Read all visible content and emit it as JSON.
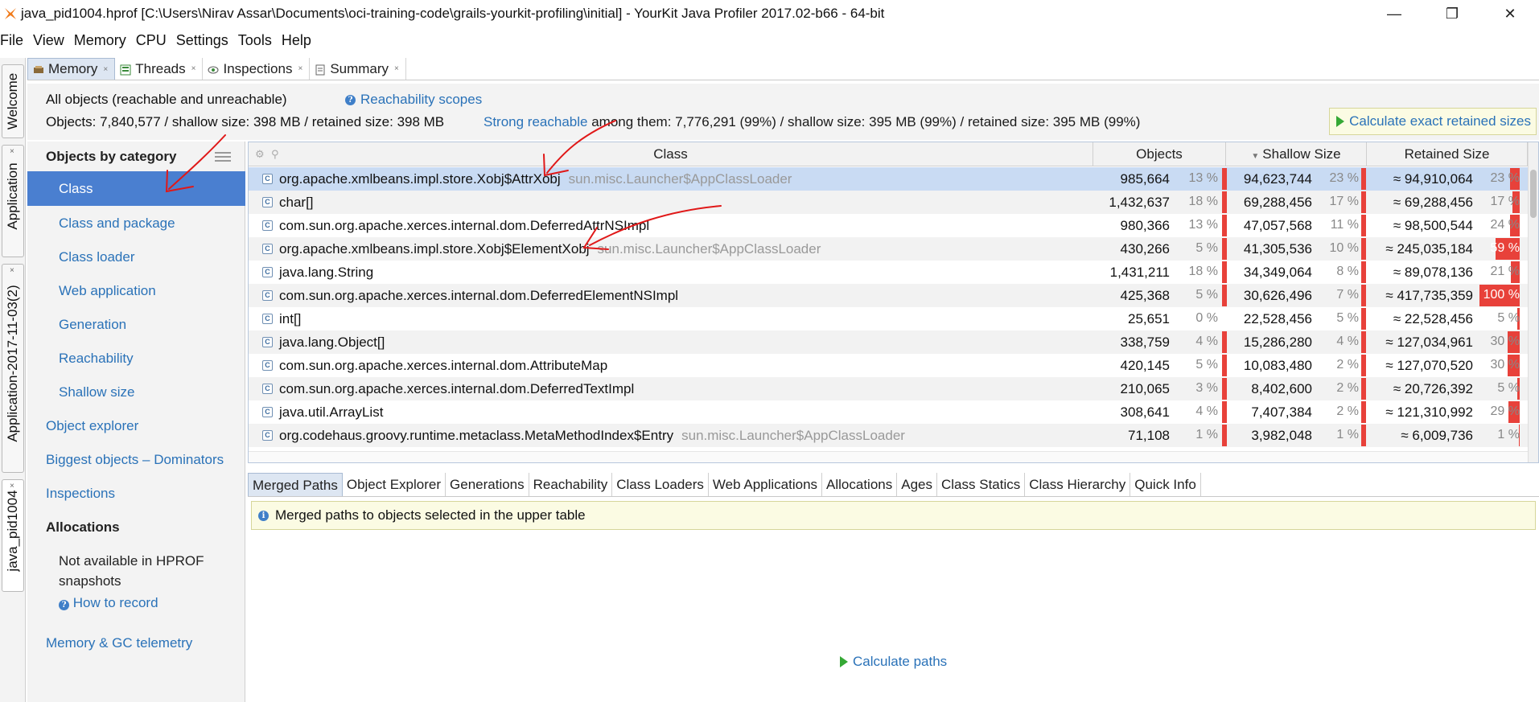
{
  "window": {
    "title": "java_pid1004.hprof [C:\\Users\\Nirav Assar\\Documents\\oci-training-code\\grails-yourkit-profiling\\initial] - YourKit Java Profiler 2017.02-b66 - 64-bit",
    "minimize": "—",
    "restore": "❐",
    "close": "✕"
  },
  "menu": [
    "File",
    "View",
    "Memory",
    "CPU",
    "Settings",
    "Tools",
    "Help"
  ],
  "vertical_tabs": [
    "Welcome",
    "Application",
    "Application-2017-11-03(2)",
    "java_pid1004"
  ],
  "top_tabs": [
    {
      "label": "Memory",
      "close": "×"
    },
    {
      "label": "Threads",
      "close": "×"
    },
    {
      "label": "Inspections",
      "close": "×"
    },
    {
      "label": "Summary",
      "close": "×"
    }
  ],
  "info": {
    "all_objects": "All objects (reachable and unreachable)",
    "reachability_scopes": "Reachability scopes",
    "objects_summary": "Objects: 7,840,577 / shallow size: 398 MB / retained size: 398 MB",
    "strong_reachable": "Strong reachable",
    "strong_summary": " among them: 7,776,291 (99%) / shallow size: 395 MB (99%) / retained size: 395 MB (99%)",
    "calc_retained": "Calculate exact retained sizes"
  },
  "categories": {
    "header": "Objects by category",
    "items": [
      "Class",
      "Class and package",
      "Class loader",
      "Web application",
      "Generation",
      "Reachability",
      "Shallow size"
    ],
    "object_explorer": "Object explorer",
    "biggest_objects": "Biggest objects – Dominators",
    "inspections": "Inspections",
    "allocations_header": "Allocations",
    "not_available": "Not available in HPROF",
    "snapshots": "snapshots",
    "how_to_record": "How to record",
    "memory_gc": "Memory & GC telemetry"
  },
  "table": {
    "columns": [
      "Class",
      "Objects",
      "Shallow Size",
      "Retained Size"
    ],
    "rows": [
      {
        "cls": "org.apache.xmlbeans.impl.store.Xobj$AttrXobj",
        "loader": "sun.misc.Launcher$AppClassLoader",
        "objects": "985,664",
        "obj_pct": "13 %",
        "obj_frac": 0.13,
        "shallow": "94,623,744",
        "sh_pct": "23 %",
        "sh_frac": 0.23,
        "retained": "≈ 94,910,064",
        "ret_pct": "23 %",
        "ret_frac": 0.23
      },
      {
        "cls": "char[]",
        "loader": "",
        "objects": "1,432,637",
        "obj_pct": "18 %",
        "obj_frac": 0.18,
        "shallow": "69,288,456",
        "sh_pct": "17 %",
        "sh_frac": 0.17,
        "retained": "≈ 69,288,456",
        "ret_pct": "17 %",
        "ret_frac": 0.17
      },
      {
        "cls": "com.sun.org.apache.xerces.internal.dom.DeferredAttrNSImpl",
        "loader": "",
        "objects": "980,366",
        "obj_pct": "13 %",
        "obj_frac": 0.13,
        "shallow": "47,057,568",
        "sh_pct": "11 %",
        "sh_frac": 0.11,
        "retained": "≈ 98,500,544",
        "ret_pct": "24 %",
        "ret_frac": 0.24
      },
      {
        "cls": "org.apache.xmlbeans.impl.store.Xobj$ElementXobj",
        "loader": "sun.misc.Launcher$AppClassLoader",
        "objects": "430,266",
        "obj_pct": "5 %",
        "obj_frac": 0.05,
        "shallow": "41,305,536",
        "sh_pct": "10 %",
        "sh_frac": 0.1,
        "retained": "≈ 245,035,184",
        "ret_pct": "59 %",
        "ret_frac": 0.59
      },
      {
        "cls": "java.lang.String",
        "loader": "",
        "objects": "1,431,211",
        "obj_pct": "18 %",
        "obj_frac": 0.18,
        "shallow": "34,349,064",
        "sh_pct": "8 %",
        "sh_frac": 0.08,
        "retained": "≈ 89,078,136",
        "ret_pct": "21 %",
        "ret_frac": 0.21
      },
      {
        "cls": "com.sun.org.apache.xerces.internal.dom.DeferredElementNSImpl",
        "loader": "",
        "objects": "425,368",
        "obj_pct": "5 %",
        "obj_frac": 0.05,
        "shallow": "30,626,496",
        "sh_pct": "7 %",
        "sh_frac": 0.07,
        "retained": "≈ 417,735,359",
        "ret_pct": "100 %",
        "ret_frac": 1.0
      },
      {
        "cls": "int[]",
        "loader": "",
        "objects": "25,651",
        "obj_pct": "0 %",
        "obj_frac": 0.0,
        "shallow": "22,528,456",
        "sh_pct": "5 %",
        "sh_frac": 0.05,
        "retained": "≈ 22,528,456",
        "ret_pct": "5 %",
        "ret_frac": 0.05
      },
      {
        "cls": "java.lang.Object[]",
        "loader": "",
        "objects": "338,759",
        "obj_pct": "4 %",
        "obj_frac": 0.04,
        "shallow": "15,286,280",
        "sh_pct": "4 %",
        "sh_frac": 0.04,
        "retained": "≈ 127,034,961",
        "ret_pct": "30 %",
        "ret_frac": 0.3
      },
      {
        "cls": "com.sun.org.apache.xerces.internal.dom.AttributeMap",
        "loader": "",
        "objects": "420,145",
        "obj_pct": "5 %",
        "obj_frac": 0.05,
        "shallow": "10,083,480",
        "sh_pct": "2 %",
        "sh_frac": 0.02,
        "retained": "≈ 127,070,520",
        "ret_pct": "30 %",
        "ret_frac": 0.3
      },
      {
        "cls": "com.sun.org.apache.xerces.internal.dom.DeferredTextImpl",
        "loader": "",
        "objects": "210,065",
        "obj_pct": "3 %",
        "obj_frac": 0.03,
        "shallow": "8,402,600",
        "sh_pct": "2 %",
        "sh_frac": 0.02,
        "retained": "≈ 20,726,392",
        "ret_pct": "5 %",
        "ret_frac": 0.05
      },
      {
        "cls": "java.util.ArrayList",
        "loader": "",
        "objects": "308,641",
        "obj_pct": "4 %",
        "obj_frac": 0.04,
        "shallow": "7,407,384",
        "sh_pct": "2 %",
        "sh_frac": 0.02,
        "retained": "≈ 121,310,992",
        "ret_pct": "29 %",
        "ret_frac": 0.29
      },
      {
        "cls": "org.codehaus.groovy.runtime.metaclass.MetaMethodIndex$Entry",
        "loader": "sun.misc.Launcher$AppClassLoader",
        "objects": "71,108",
        "obj_pct": "1 %",
        "obj_frac": 0.01,
        "shallow": "3,982,048",
        "sh_pct": "1 %",
        "sh_frac": 0.01,
        "retained": "≈ 6,009,736",
        "ret_pct": "1 %",
        "ret_frac": 0.01
      }
    ]
  },
  "bottom_tabs": [
    "Merged Paths",
    "Object Explorer",
    "Generations",
    "Reachability",
    "Class Loaders",
    "Web Applications",
    "Allocations",
    "Ages",
    "Class Statics",
    "Class Hierarchy",
    "Quick Info"
  ],
  "merged_info": "Merged paths to objects selected in the upper table",
  "calc_paths": "Calculate paths",
  "colors": {
    "accent": "#4a7fd0",
    "link": "#2a72b8",
    "bar": "#e8413a",
    "selection": "#c9dbf3"
  }
}
